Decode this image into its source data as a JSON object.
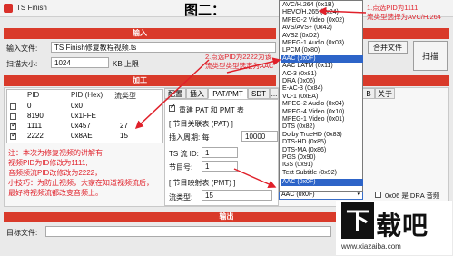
{
  "window": {
    "app_title": "TS Finish",
    "caption": "图二：",
    "min_label": "—",
    "max_label": "□",
    "close_label": "✕"
  },
  "input_section": {
    "header": "输入",
    "file_label": "输入文件:",
    "file_value": "TS Finish修复教程视频.ts",
    "scan_size_label": "扫描大小:",
    "scan_size_value": "1024",
    "scan_size_unit": "KB 上限",
    "merge_button": "合并文件",
    "scan_button": "扫描"
  },
  "processing_section": {
    "header": "加工",
    "pid_table": {
      "headers": [
        "PID",
        "PID (Hex)",
        "流类型"
      ],
      "rows": [
        {
          "pid": "0",
          "hex": "0x0",
          "type": "",
          "checked": false
        },
        {
          "pid": "8190",
          "hex": "0x1FFE",
          "type": "",
          "checked": false
        },
        {
          "pid": "1111",
          "hex": "0x457",
          "type": "27",
          "checked": true
        },
        {
          "pid": "2222",
          "hex": "0x8AE",
          "type": "15",
          "checked": true
        }
      ]
    },
    "tabs": [
      "配置",
      "插入",
      "PAT/PMT",
      "SDT",
      "...",
      "B",
      "关于"
    ],
    "active_tab": "PAT/PMT",
    "rebuild_label": "重建 PAT 和 PMT 表",
    "section_program_table": "[ 节目关联表 (PAT) ]",
    "insert_period_label": "插入周期: 每",
    "insert_period_value": "10000",
    "ts_id_label": "TS 流 ID:",
    "ts_id_value": "1",
    "program_no_label": "节目号:",
    "program_no_value": "1",
    "section_pmt": "[ 节目映射表 (PMT) ]",
    "stream_type_label": "流类型:",
    "stream_type_value": "15",
    "selected_codec": "AAC (0x0F)",
    "dra_label": "0x06 是 DRA 音频"
  },
  "annotations": {
    "note1": "1.点选PID为1111\n流类型选择为AVC/H.264",
    "note2": "2.点选PID为2222为该\n流类型类型选定为AAC",
    "note_main": "注：本次为修复视频的讲解有\n视频PID为ID修改为1111,\n音频频流PID改修改为2222，\n小技巧：为防止视频，大家在知道视频流后，\n最好将视频流都改变音频上。"
  },
  "output_section": {
    "header": "输出",
    "target_label": "目标文件:"
  },
  "codec_dropdown": {
    "items": [
      "AVC/H.264 (0x1B)",
      "HEVC/H.265 (0x24)",
      "MPEG-2 Video (0x02)",
      "AVS/AVS+ (0x42)",
      "AVS2 (0xD2)",
      "MPEG-1 Audio (0x03)",
      "LPCM (0x80)",
      "AAC (0x0F)",
      "AAC LATM (0x11)",
      "AC-3 (0x81)",
      "DRA (0x06)",
      "E-AC-3 (0x84)",
      "VC-1 (0xEA)",
      "MPEG-2 Audio (0x04)",
      "MPEG-4 Video (0x10)",
      "MPEG-1 Video (0x01)",
      "DTS (0x82)",
      "Dolby TrueHD (0x83)",
      "DTS-HD (0x85)",
      "DTS-MA (0x86)",
      "PGS (0x90)",
      "IGS (0x91)",
      "Text Subtitle (0x92)",
      "AAC (0x0F)"
    ],
    "selected_index": 7
  },
  "watermark": {
    "text": "下载吧",
    "url": "www.xiazaiba.com"
  },
  "colors": {
    "accent_red": "#d93a2a",
    "selection_blue": "#2d64c8"
  }
}
